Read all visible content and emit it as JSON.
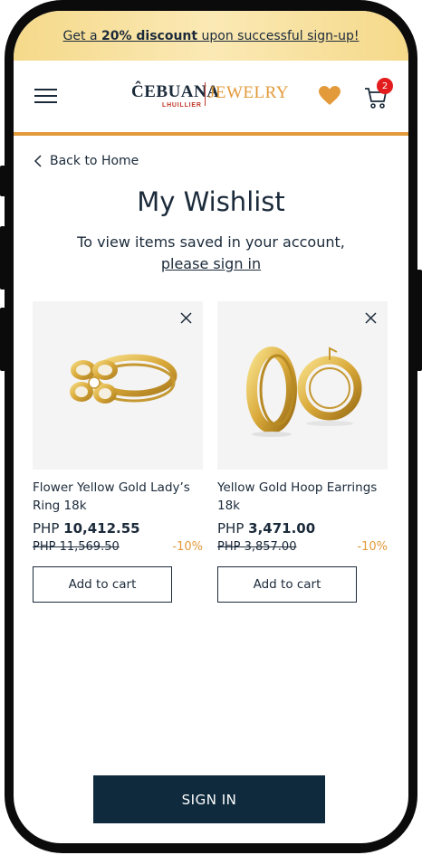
{
  "promo": {
    "prefix": "Get a ",
    "highlight": "20% discount",
    "suffix": " upon successful sign-up!"
  },
  "header": {
    "logo_main": "ĈEBUANA",
    "logo_sub": "LHUILLIER",
    "logo_right": "JEWELRY",
    "cart_count": "2"
  },
  "nav": {
    "back_label": "Back to Home"
  },
  "page": {
    "title": "My Wishlist",
    "subtitle": "To view items saved in your account,",
    "signin_link": "please sign in"
  },
  "products": [
    {
      "name": "Flower Yellow Gold Lady’s Ring 18k",
      "currency": "PHP ",
      "price": "10,412.55",
      "original_price": "PHP 11,569.50",
      "discount": "-10%",
      "add_label": "Add to cart"
    },
    {
      "name": "Yellow Gold Hoop Earrings 18k",
      "currency": "PHP ",
      "price": "3,471.00",
      "original_price": "PHP 3,857.00",
      "discount": "-10%",
      "add_label": "Add to cart"
    }
  ],
  "footer": {
    "signin_button": "SIGN IN"
  },
  "colors": {
    "accent": "#e39a3a",
    "navy": "#0f2a3d",
    "badge": "#e31d1d",
    "promo_bg": "#f5d98a"
  }
}
